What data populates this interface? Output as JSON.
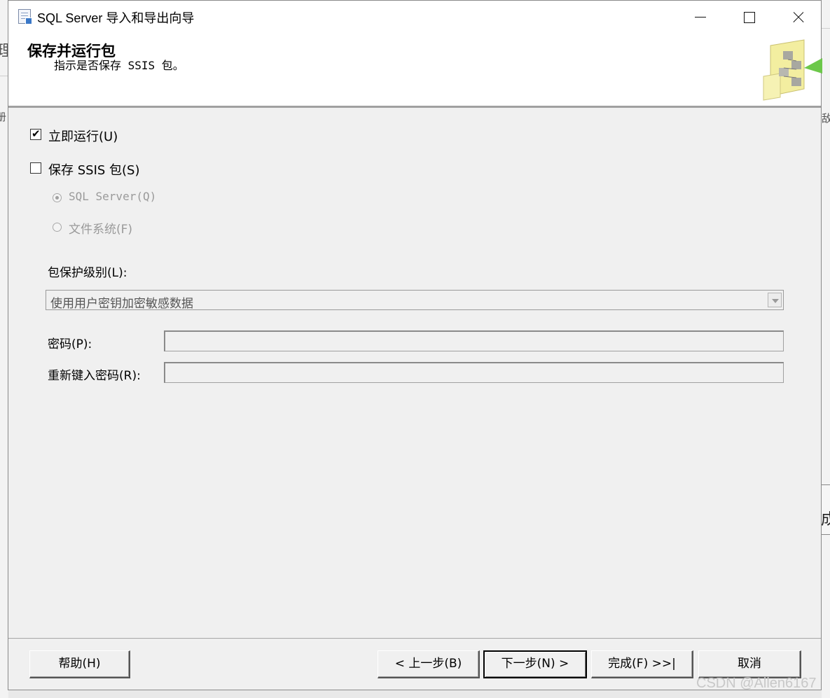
{
  "window": {
    "title": "SQL Server 导入和导出向导",
    "minimize_icon": "minimize-icon",
    "maximize_icon": "maximize-icon",
    "close_icon": "close-icon"
  },
  "background": {
    "left_char_1": "理",
    "left_char_2": "册",
    "right_char_1": "敌",
    "right_char_2": "成"
  },
  "header": {
    "title": "保存并运行包",
    "subtitle": "指示是否保存 SSIS 包。",
    "graphic": "package-flow-icon"
  },
  "options": {
    "run_immediately": {
      "label": "立即运行(U)",
      "checked": true
    },
    "save_package": {
      "label": "保存 SSIS 包(S)",
      "checked": false
    },
    "sql_server": {
      "label": "SQL Server(Q)",
      "selected": true,
      "enabled": false
    },
    "file_system": {
      "label": "文件系统(F)",
      "selected": false,
      "enabled": false
    }
  },
  "protection": {
    "label": "包保护级别(L):",
    "value": "使用用户密钥加密敏感数据"
  },
  "password": {
    "label": "密码(P):",
    "value": ""
  },
  "retype": {
    "label": "重新键入密码(R):",
    "value": ""
  },
  "footer": {
    "help": "帮助(H)",
    "back": "< 上一步(B)",
    "next": "下一步(N) >",
    "finish": "完成(F) >>|",
    "cancel": "取消"
  },
  "watermark": "CSDN @Allen6167",
  "colors": {
    "window_bg": "#f0f0f0",
    "header_bg": "#ffffff",
    "disabled_text": "#9a9a9a"
  }
}
